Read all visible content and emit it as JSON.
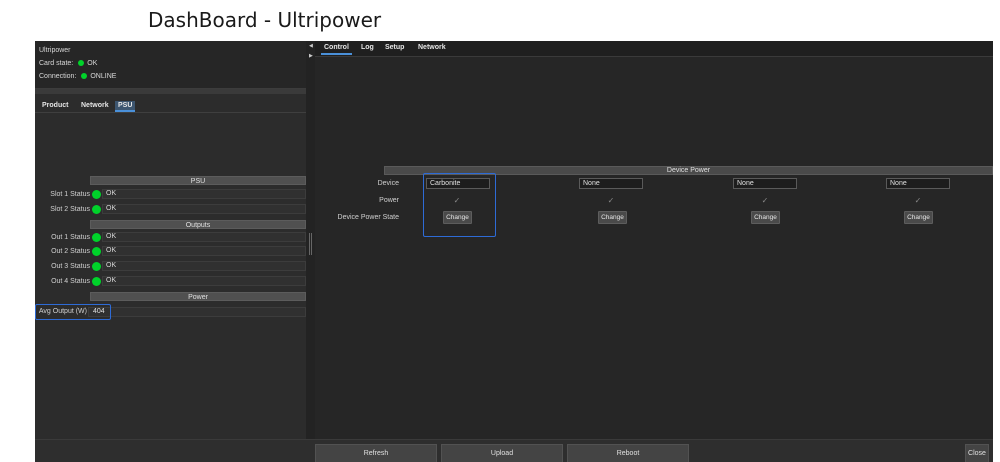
{
  "page_title": "DashBoard - Ultripower",
  "info": {
    "device_name": "Ultripower",
    "card_state_label": "Card state:",
    "card_state_value": "OK",
    "connection_label": "Connection:",
    "connection_value": "ONLINE"
  },
  "left_tabs": [
    "Product",
    "Network",
    "PSU"
  ],
  "psu": {
    "psu_header": "PSU",
    "slot_rows": [
      {
        "label": "Slot 1 Status",
        "value": "OK"
      },
      {
        "label": "Slot 2 Status",
        "value": "OK"
      }
    ],
    "outputs_header": "Outputs",
    "output_rows": [
      {
        "label": "Out 1 Status",
        "value": "OK"
      },
      {
        "label": "Out 2 Status",
        "value": "OK"
      },
      {
        "label": "Out 3 Status",
        "value": "OK"
      },
      {
        "label": "Out 4 Status",
        "value": "OK"
      }
    ],
    "power_header": "Power",
    "avg_output_label": "Avg Output (W)",
    "avg_output_value": "404"
  },
  "right_tabs": [
    "Control",
    "Log",
    "Setup",
    "Network"
  ],
  "device_power": {
    "header": "Device Power",
    "device_label": "Device",
    "power_label": "Power",
    "state_label": "Device Power State",
    "devices": [
      "Carbonite",
      "None",
      "None",
      "None"
    ],
    "check_glyph": "✓",
    "change_label": "Change"
  },
  "bottom": {
    "refresh": "Refresh",
    "upload": "Upload",
    "reboot": "Reboot",
    "close": "Close"
  },
  "colors": {
    "status_ok": "#00d22a",
    "highlight": "#2e6bd6",
    "tab_accent": "#4a90d9"
  }
}
